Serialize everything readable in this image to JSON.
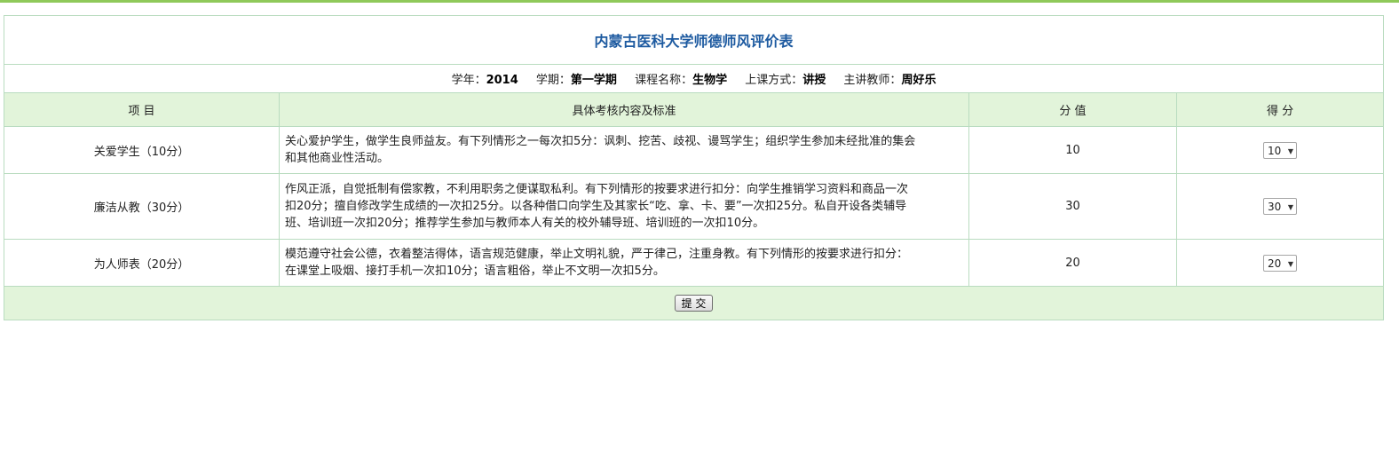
{
  "form": {
    "title": "内蒙古医科大学师德师风评价表",
    "info": {
      "year_label": "学年：",
      "year_value": "2014",
      "term_label": "学期：",
      "term_value": "第一学期",
      "course_label": "课程名称：",
      "course_value": "生物学",
      "method_label": "上课方式：",
      "method_value": "讲授",
      "teacher_label": "主讲教师：",
      "teacher_value": "周好乐"
    },
    "headers": {
      "item": "项 目",
      "content": "具体考核内容及标准",
      "score": "分 值",
      "get": "得 分"
    },
    "rows": [
      {
        "item": "关爱学生（10分）",
        "desc_lines": [
          "关心爱护学生，做学生良师益友。有下列情形之一每次扣5分：讽刺、挖苦、歧视、谩骂学生；组织学生参加未经批准的集会",
          "和其他商业性活动。"
        ],
        "score": "10",
        "selected": "10"
      },
      {
        "item": "廉洁从教（30分）",
        "desc_lines": [
          "作风正派，自觉抵制有偿家教，不利用职务之便谋取私利。有下列情形的按要求进行扣分：向学生推销学习资料和商品一次",
          "扣20分；擅自修改学生成绩的一次扣25分。以各种借口向学生及其家长“吃、拿、卡、要”一次扣25分。私自开设各类辅导",
          "班、培训班一次扣20分；推荐学生参加与教师本人有关的校外辅导班、培训班的一次扣10分。"
        ],
        "score": "30",
        "selected": "30"
      },
      {
        "item": "为人师表（20分）",
        "desc_lines": [
          "模范遵守社会公德，衣着整洁得体，语言规范健康，举止文明礼貌，严于律己，注重身教。有下列情形的按要求进行扣分：",
          "在课堂上吸烟、接打手机一次扣10分；语言粗俗，举止不文明一次扣5分。"
        ],
        "score": "20",
        "selected": "20"
      }
    ],
    "submit_label": "提 交",
    "dropdown_arrow": "▼"
  }
}
